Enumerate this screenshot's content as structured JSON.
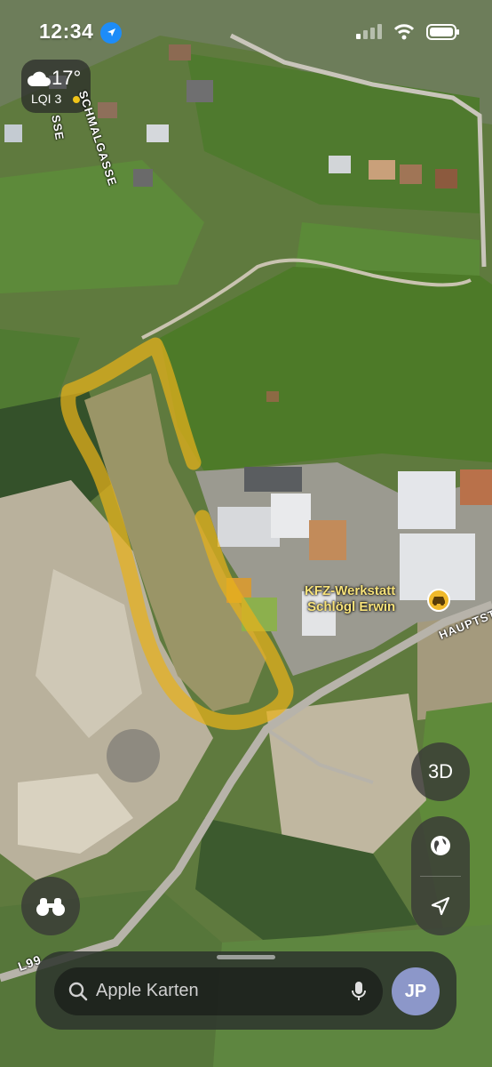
{
  "status_bar": {
    "time": "12:34"
  },
  "weather": {
    "temperature": "17°",
    "lqi_label": "LQI 3"
  },
  "map": {
    "poi_name_line1": "KFZ-Werkstatt",
    "poi_name_line2": "Schlögl Erwin",
    "street_schmalgasse": "SCHMALGASSE",
    "street_gasse_fragment": "SSE",
    "street_hauptstrasse": "HAUPTST",
    "road_label": "L99",
    "poi_icon": "car-icon"
  },
  "controls": {
    "three_d_label": "3D"
  },
  "search": {
    "placeholder": "Apple Karten"
  },
  "profile": {
    "initials": "JP"
  },
  "colors": {
    "highlight": "#e8b21a",
    "accent_blue": "#1d8cf8",
    "poi_yellow": "#f0b92b",
    "avatar": "#8c97c9"
  }
}
